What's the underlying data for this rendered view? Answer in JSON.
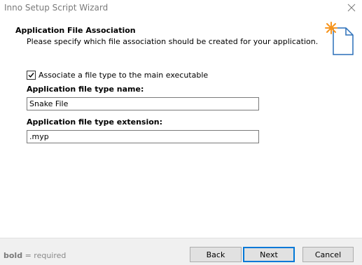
{
  "window": {
    "title": "Inno Setup Script Wizard"
  },
  "header": {
    "title": "Application File Association",
    "subtitle": "Please specify which file association should be created for your application.",
    "icon": "wizard-page-icon"
  },
  "form": {
    "associate_checkbox": {
      "label": "Associate a file type to the main executable",
      "checked": true
    },
    "type_name": {
      "label": "Application file type name:",
      "value": "Snake File"
    },
    "type_extension": {
      "label": "Application file type extension:",
      "value": ".myp"
    }
  },
  "footer": {
    "hint_bold": "bold",
    "hint_rest": " = required",
    "back_label": "Back",
    "next_label": "Next",
    "cancel_label": "Cancel"
  },
  "colors": {
    "accent": "#0078d7",
    "star": "#f7941d"
  }
}
